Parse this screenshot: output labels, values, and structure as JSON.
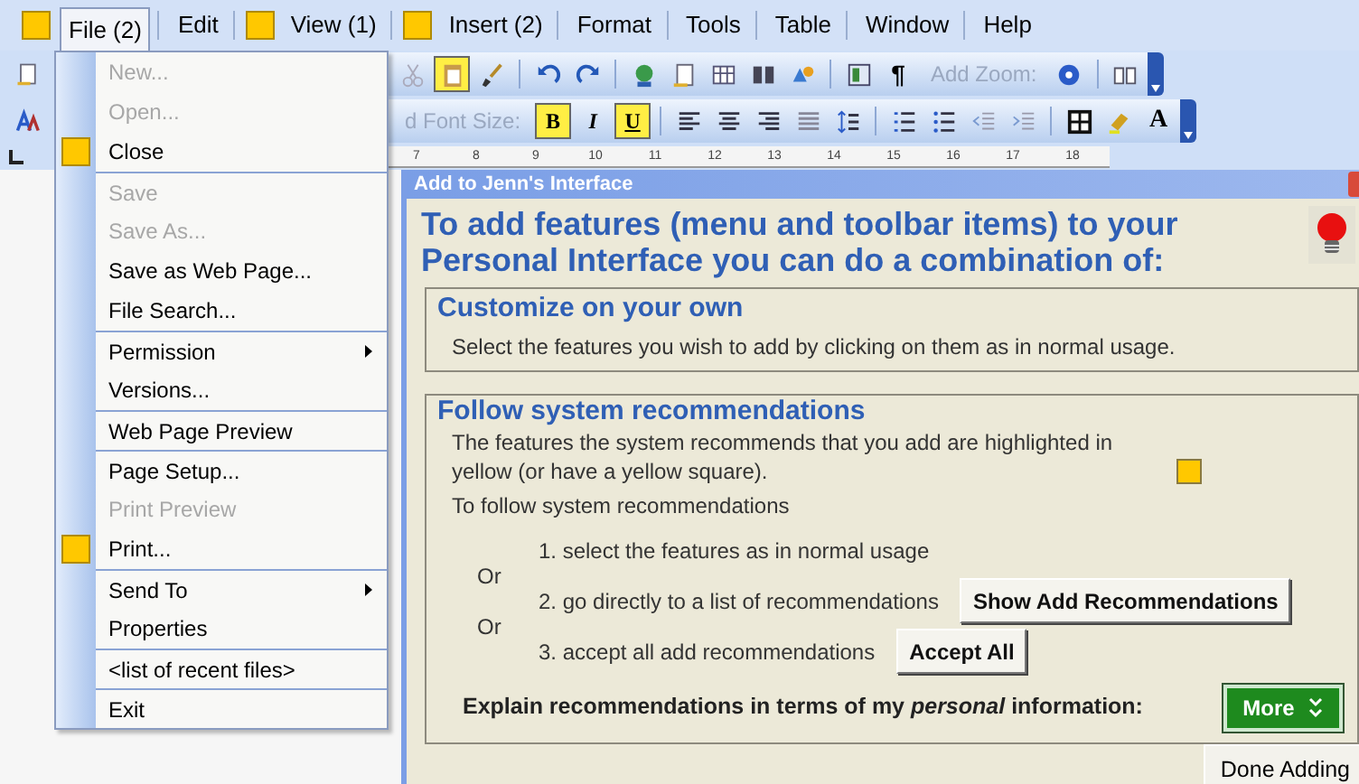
{
  "menu_bar": {
    "items": [
      {
        "label": "File (2)",
        "recommended": true,
        "selected": true
      },
      {
        "label": "Edit",
        "recommended": false,
        "selected": false
      },
      {
        "label": "View (1)",
        "recommended": true,
        "selected": false
      },
      {
        "label": "Insert (2)",
        "recommended": true,
        "selected": false
      },
      {
        "label": "Format",
        "recommended": false,
        "selected": false
      },
      {
        "label": "Tools",
        "recommended": false,
        "selected": false
      },
      {
        "label": "Table",
        "recommended": false,
        "selected": false
      },
      {
        "label": "Window",
        "recommended": false,
        "selected": false
      },
      {
        "label": "Help",
        "recommended": false,
        "selected": false
      }
    ]
  },
  "toolbars": [
    {
      "items": [
        {
          "kind": "icon",
          "highlighted": false
        },
        {
          "kind": "icon",
          "highlighted": true
        },
        {
          "kind": "icon",
          "highlighted": false
        },
        {
          "kind": "separator"
        },
        {
          "kind": "icon",
          "highlighted": false
        },
        {
          "kind": "icon",
          "highlighted": false
        },
        {
          "kind": "separator"
        },
        {
          "kind": "icon",
          "highlighted": false
        },
        {
          "kind": "icon",
          "highlighted": false
        },
        {
          "kind": "icon",
          "highlighted": false
        },
        {
          "kind": "icon",
          "highlighted": false
        },
        {
          "kind": "icon",
          "highlighted": false
        },
        {
          "kind": "separator"
        },
        {
          "kind": "icon",
          "highlighted": false
        },
        {
          "kind": "text",
          "label": "¶",
          "highlighted": false
        },
        {
          "kind": "label",
          "label": "Add Zoom:"
        },
        {
          "kind": "icon",
          "highlighted": false
        },
        {
          "kind": "separator"
        },
        {
          "kind": "icon",
          "highlighted": false
        }
      ]
    },
    {
      "items": [
        {
          "kind": "label",
          "label": "d Font Size:"
        },
        {
          "kind": "text",
          "label": "B",
          "highlighted": true
        },
        {
          "kind": "text",
          "label": "I",
          "highlighted": false
        },
        {
          "kind": "text",
          "label": "U",
          "highlighted": true
        },
        {
          "kind": "separator"
        },
        {
          "kind": "icon",
          "highlighted": false
        },
        {
          "kind": "icon",
          "highlighted": false
        },
        {
          "kind": "icon",
          "highlighted": false
        },
        {
          "kind": "icon",
          "highlighted": false
        },
        {
          "kind": "icon",
          "highlighted": false
        },
        {
          "kind": "separator"
        },
        {
          "kind": "icon",
          "highlighted": false
        },
        {
          "kind": "icon",
          "highlighted": false
        },
        {
          "kind": "icon",
          "highlighted": false
        },
        {
          "kind": "icon",
          "highlighted": false
        },
        {
          "kind": "separator"
        },
        {
          "kind": "icon",
          "highlighted": false
        },
        {
          "kind": "icon",
          "highlighted": false
        },
        {
          "kind": "text",
          "label": "A",
          "highlighted": false
        }
      ]
    }
  ],
  "ruler": {
    "numbers": [
      "7",
      "8",
      "9",
      "10",
      "11",
      "12",
      "13",
      "14",
      "15",
      "16",
      "17",
      "18"
    ]
  },
  "file_menu": {
    "items": [
      {
        "label": "New...",
        "disabled": true,
        "recommended": false,
        "submenu": false,
        "separator_before": false
      },
      {
        "label": "Open...",
        "disabled": true,
        "recommended": false,
        "submenu": false,
        "separator_before": false
      },
      {
        "label": "Close",
        "disabled": false,
        "recommended": true,
        "submenu": false,
        "separator_before": false
      },
      {
        "label": "Save",
        "disabled": true,
        "recommended": false,
        "submenu": false,
        "separator_before": true
      },
      {
        "label": "Save As...",
        "disabled": true,
        "recommended": false,
        "submenu": false,
        "separator_before": false
      },
      {
        "label": "Save as Web Page...",
        "disabled": false,
        "recommended": false,
        "submenu": false,
        "separator_before": false
      },
      {
        "label": "File Search...",
        "disabled": false,
        "recommended": false,
        "submenu": false,
        "separator_before": false
      },
      {
        "label": "Permission",
        "disabled": false,
        "recommended": false,
        "submenu": true,
        "separator_before": true
      },
      {
        "label": "Versions...",
        "disabled": false,
        "recommended": false,
        "submenu": false,
        "separator_before": false
      },
      {
        "label": "Web Page Preview",
        "disabled": false,
        "recommended": false,
        "submenu": false,
        "separator_before": true
      },
      {
        "label": "Page Setup...",
        "disabled": false,
        "recommended": false,
        "submenu": false,
        "separator_before": true
      },
      {
        "label": "Print Preview",
        "disabled": true,
        "recommended": false,
        "submenu": false,
        "separator_before": false
      },
      {
        "label": "Print...",
        "disabled": false,
        "recommended": true,
        "submenu": false,
        "separator_before": false
      },
      {
        "label": "Send To",
        "disabled": false,
        "recommended": false,
        "submenu": true,
        "separator_before": true
      },
      {
        "label": "Properties",
        "disabled": false,
        "recommended": false,
        "submenu": false,
        "separator_before": false
      },
      {
        "label": "<list of recent files>",
        "disabled": false,
        "recommended": false,
        "submenu": false,
        "separator_before": true
      },
      {
        "label": "Exit",
        "disabled": false,
        "recommended": false,
        "submenu": false,
        "separator_before": true
      }
    ]
  },
  "dialog": {
    "title": "Add to Jenn's Interface",
    "heading": "To add features (menu and toolbar items) to your Personal Interface you can do a combination of:",
    "customize": {
      "title": "Customize on your own",
      "text": "Select the features you wish to add by clicking on them as in normal usage."
    },
    "recommendations": {
      "title": "Follow system recommendations",
      "text": "The features the system recommends that you add are highlighted in yellow (or have a yellow square).",
      "subtitle": "To follow system recommendations",
      "steps": [
        {
          "text": "1. select the features as in normal usage"
        },
        {
          "or": "Or",
          "text": "2. go directly to a list of recommendations",
          "button": "Show Add Recommendations"
        },
        {
          "or": "Or",
          "text": "3. accept all add recommendations",
          "button": "Accept All"
        }
      ],
      "explain": "Explain recommendations in terms of my *personal* information:",
      "more_button": "More"
    },
    "done_button": "Done Adding"
  }
}
